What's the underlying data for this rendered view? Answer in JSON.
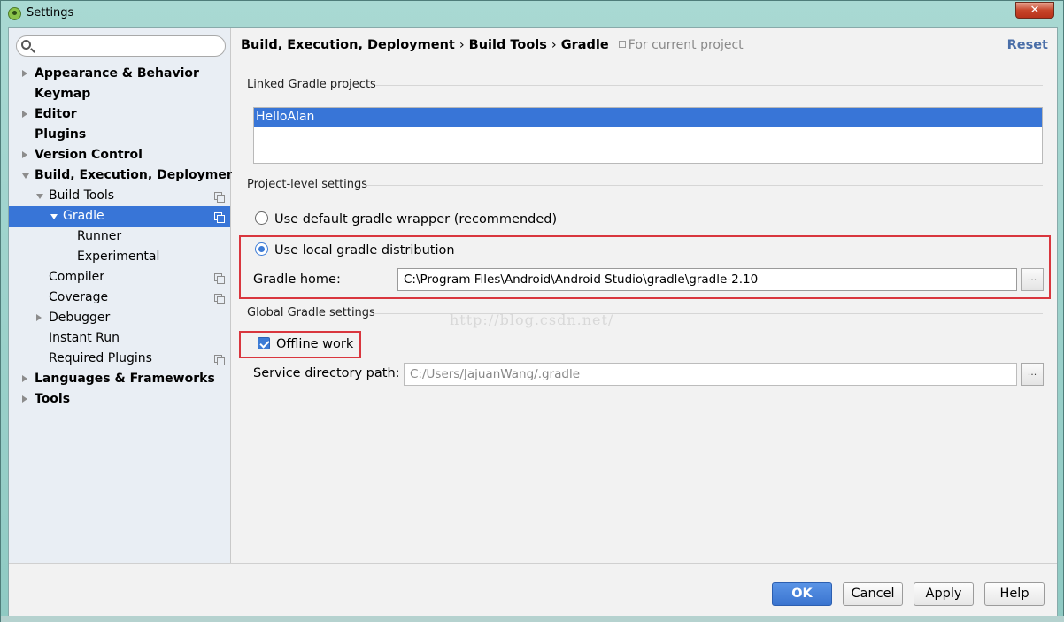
{
  "window": {
    "title": "Settings",
    "close_label": "✕"
  },
  "search": {
    "placeholder": ""
  },
  "tree": [
    {
      "label": "Appearance & Behavior",
      "bold": true,
      "arrow": "right",
      "indent": 0,
      "selected": false,
      "proj": false
    },
    {
      "label": "Keymap",
      "bold": true,
      "arrow": "none",
      "indent": 0,
      "selected": false,
      "proj": false
    },
    {
      "label": "Editor",
      "bold": true,
      "arrow": "right",
      "indent": 0,
      "selected": false,
      "proj": false
    },
    {
      "label": "Plugins",
      "bold": true,
      "arrow": "none",
      "indent": 0,
      "selected": false,
      "proj": false
    },
    {
      "label": "Version Control",
      "bold": true,
      "arrow": "right",
      "indent": 0,
      "selected": false,
      "proj": false
    },
    {
      "label": "Build, Execution, Deployment",
      "bold": true,
      "arrow": "down",
      "indent": 0,
      "selected": false,
      "proj": false
    },
    {
      "label": "Build Tools",
      "bold": false,
      "arrow": "down",
      "indent": 1,
      "selected": false,
      "proj": true
    },
    {
      "label": "Gradle",
      "bold": false,
      "arrow": "down",
      "indent": 2,
      "selected": true,
      "proj": true
    },
    {
      "label": "Runner",
      "bold": false,
      "arrow": "none",
      "indent": 3,
      "selected": false,
      "proj": false
    },
    {
      "label": "Experimental",
      "bold": false,
      "arrow": "none",
      "indent": 3,
      "selected": false,
      "proj": false
    },
    {
      "label": "Compiler",
      "bold": false,
      "arrow": "none",
      "indent": 1,
      "selected": false,
      "proj": true
    },
    {
      "label": "Coverage",
      "bold": false,
      "arrow": "none",
      "indent": 1,
      "selected": false,
      "proj": true
    },
    {
      "label": "Debugger",
      "bold": false,
      "arrow": "right",
      "indent": 1,
      "selected": false,
      "proj": false
    },
    {
      "label": "Instant Run",
      "bold": false,
      "arrow": "none",
      "indent": 1,
      "selected": false,
      "proj": false
    },
    {
      "label": "Required Plugins",
      "bold": false,
      "arrow": "none",
      "indent": 1,
      "selected": false,
      "proj": true
    },
    {
      "label": "Languages & Frameworks",
      "bold": true,
      "arrow": "right",
      "indent": 0,
      "selected": false,
      "proj": false
    },
    {
      "label": "Tools",
      "bold": true,
      "arrow": "right",
      "indent": 0,
      "selected": false,
      "proj": false
    }
  ],
  "breadcrumb": {
    "part1": "Build, Execution, Deployment",
    "part2": "Build Tools",
    "part3": "Gradle",
    "separator": "›",
    "scope": "For current project"
  },
  "reset_label": "Reset",
  "linked": {
    "title": "Linked Gradle projects",
    "projects": [
      "HelloAlan"
    ]
  },
  "project_level": {
    "title": "Project-level settings",
    "option_wrapper": "Use default gradle wrapper (recommended)",
    "option_local": "Use local gradle distribution",
    "selected": "local",
    "gradle_home_label": "Gradle home:",
    "gradle_home_value": "C:\\Program Files\\Android\\Android Studio\\gradle\\gradle-2.10"
  },
  "global": {
    "title": "Global Gradle settings",
    "offline_label": "Offline work",
    "offline_checked": true,
    "service_dir_label": "Service directory path:",
    "service_dir_value": "C:/Users/JajuanWang/.gradle"
  },
  "watermark": "http://blog.csdn.net/",
  "browse_label": "...",
  "buttons": {
    "ok": "OK",
    "cancel": "Cancel",
    "apply": "Apply",
    "help": "Help"
  },
  "colors": {
    "selection": "#3875d7",
    "highlight_box": "#d9363e",
    "link": "#4a6ea8"
  }
}
